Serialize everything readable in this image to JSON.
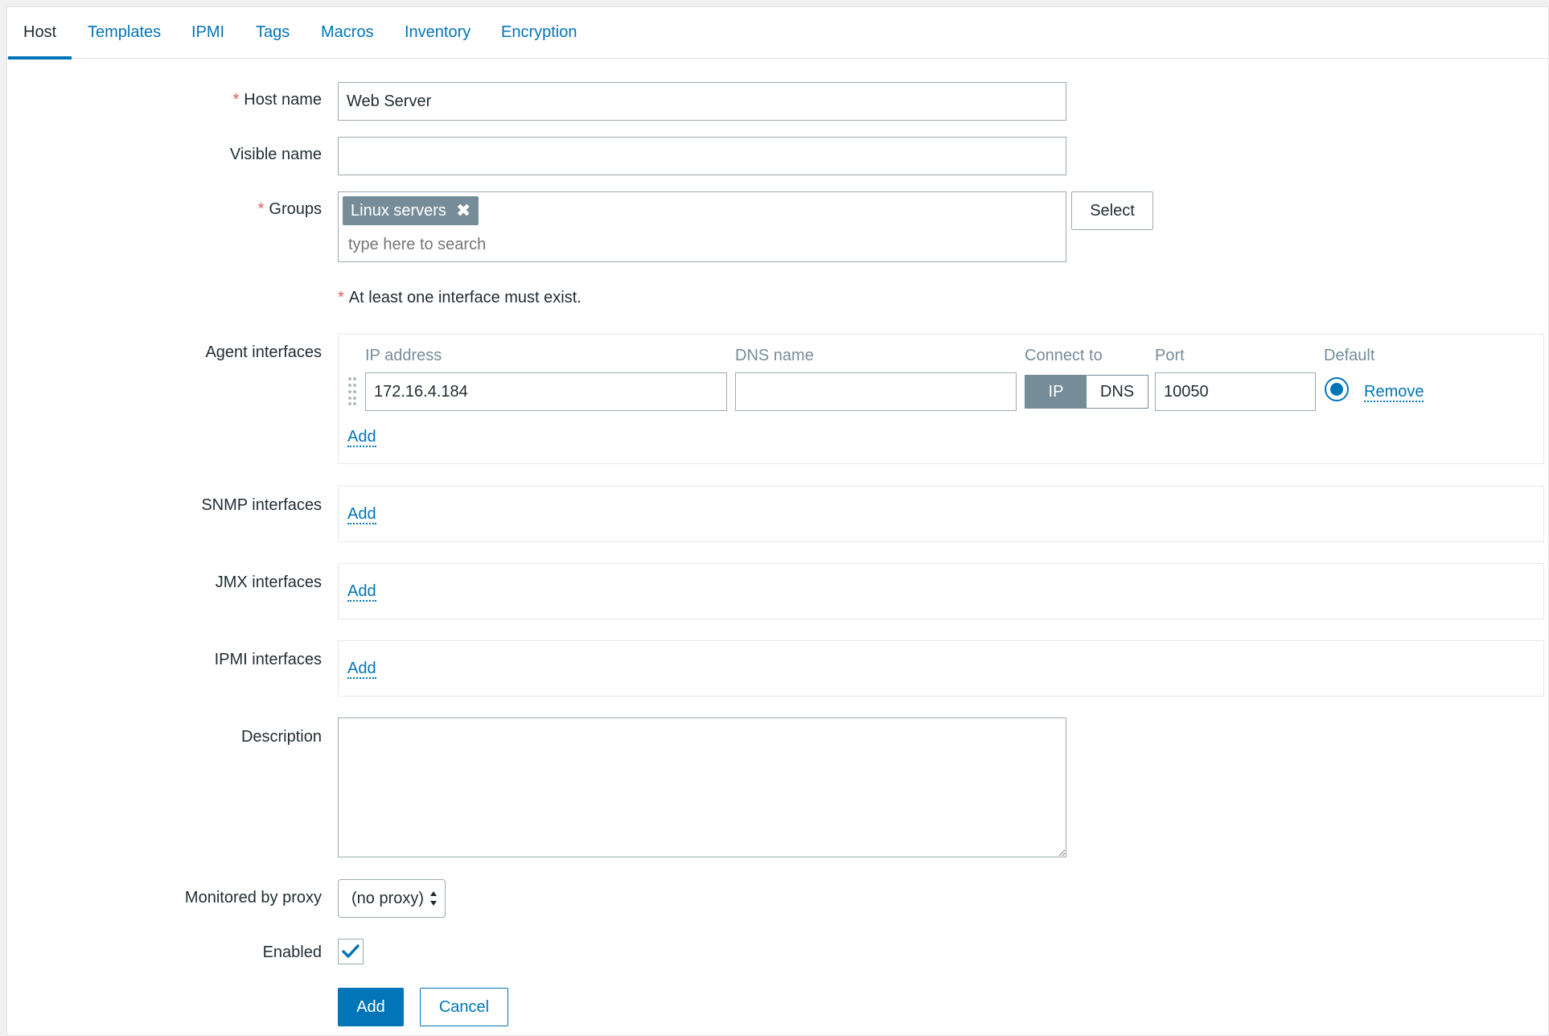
{
  "tabs": [
    {
      "label": "Host",
      "active": true
    },
    {
      "label": "Templates"
    },
    {
      "label": "IPMI"
    },
    {
      "label": "Tags"
    },
    {
      "label": "Macros"
    },
    {
      "label": "Inventory"
    },
    {
      "label": "Encryption"
    }
  ],
  "form": {
    "host_name": {
      "label": "Host name",
      "value": "Web Server"
    },
    "visible_name": {
      "label": "Visible name",
      "value": ""
    },
    "groups": {
      "label": "Groups",
      "chip": "Linux servers",
      "placeholder": "type here to search",
      "select_label": "Select"
    },
    "interface_note": "At least one interface must exist.",
    "agent_interfaces": {
      "label": "Agent interfaces",
      "columns": {
        "ip": "IP address",
        "dns": "DNS name",
        "connect": "Connect to",
        "port": "Port",
        "default": "Default"
      },
      "row": {
        "ip": "172.16.4.184",
        "dns": "",
        "connect_ip": "IP",
        "connect_dns": "DNS",
        "port": "10050",
        "remove": "Remove"
      },
      "add_label": "Add"
    },
    "snmp_interfaces": {
      "label": "SNMP interfaces",
      "add_label": "Add"
    },
    "jmx_interfaces": {
      "label": "JMX interfaces",
      "add_label": "Add"
    },
    "ipmi_interfaces": {
      "label": "IPMI interfaces",
      "add_label": "Add"
    },
    "description": {
      "label": "Description",
      "value": ""
    },
    "proxy": {
      "label": "Monitored by proxy",
      "value": "(no proxy)"
    },
    "enabled": {
      "label": "Enabled",
      "checked": true
    },
    "add_button": "Add",
    "cancel_button": "Cancel"
  },
  "colors": {
    "accent": "#0275b8",
    "required": "#e45959",
    "chip": "#768d99"
  }
}
